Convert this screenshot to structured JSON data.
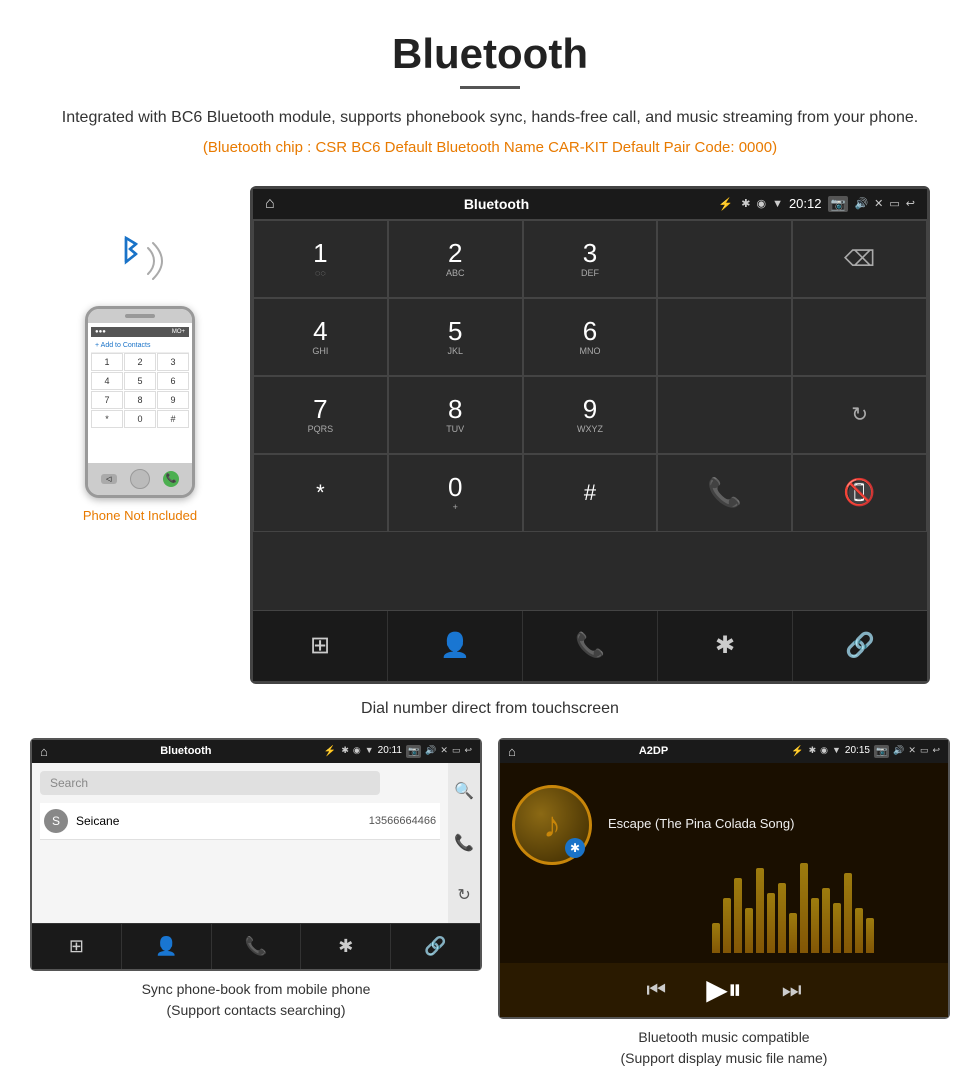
{
  "header": {
    "title": "Bluetooth",
    "description": "Integrated with BC6 Bluetooth module, supports phonebook sync, hands-free call, and music streaming from your phone.",
    "tech_info": "(Bluetooth chip : CSR BC6     Default Bluetooth Name CAR-KIT     Default Pair Code: 0000)"
  },
  "car_screen": {
    "status_bar": {
      "title": "Bluetooth",
      "time": "20:12",
      "usb_icon": "⚡",
      "bt_icon": "✱",
      "location_icon": "◉",
      "signal_icon": "▼",
      "camera_icon": "📷",
      "volume_icon": "🔊",
      "close_icon": "✕",
      "window_icon": "▭",
      "back_icon": "↩"
    },
    "keypad": {
      "rows": [
        [
          {
            "num": "1",
            "letters": "◌◌"
          },
          {
            "num": "2",
            "letters": "ABC"
          },
          {
            "num": "3",
            "letters": "DEF"
          },
          {
            "num": "",
            "letters": "",
            "type": "empty"
          },
          {
            "num": "",
            "letters": "",
            "type": "backspace"
          }
        ],
        [
          {
            "num": "4",
            "letters": "GHI"
          },
          {
            "num": "5",
            "letters": "JKL"
          },
          {
            "num": "6",
            "letters": "MNO"
          },
          {
            "num": "",
            "letters": "",
            "type": "empty"
          },
          {
            "num": "",
            "letters": "",
            "type": "empty"
          }
        ],
        [
          {
            "num": "7",
            "letters": "PQRS"
          },
          {
            "num": "8",
            "letters": "TUV"
          },
          {
            "num": "9",
            "letters": "WXYZ"
          },
          {
            "num": "",
            "letters": "",
            "type": "empty"
          },
          {
            "num": "",
            "letters": "",
            "type": "refresh"
          }
        ],
        [
          {
            "num": "*",
            "letters": ""
          },
          {
            "num": "0",
            "letters": "+",
            "type": "zero"
          },
          {
            "num": "#",
            "letters": ""
          },
          {
            "num": "",
            "letters": "",
            "type": "call_green"
          },
          {
            "num": "",
            "letters": "",
            "type": "call_red"
          }
        ]
      ]
    },
    "nav_items": [
      "⊞",
      "👤",
      "📞",
      "✱",
      "🔗"
    ]
  },
  "dial_caption": "Dial number direct from touchscreen",
  "phone_illustration": {
    "not_included": "Phone Not Included"
  },
  "phonebook_screen": {
    "status_bar": {
      "title": "Bluetooth",
      "time": "20:11"
    },
    "search_placeholder": "Search",
    "contacts": [
      {
        "initial": "S",
        "name": "Seicane",
        "phone": "13566664466"
      }
    ],
    "caption_line1": "Sync phone-book from mobile phone",
    "caption_line2": "(Support contacts searching)"
  },
  "music_screen": {
    "status_bar": {
      "title": "A2DP",
      "time": "20:15"
    },
    "song_title": "Escape (The Pina Colada Song)",
    "eq_bars": [
      30,
      55,
      75,
      45,
      85,
      60,
      70,
      40,
      90,
      55,
      65,
      50,
      80,
      45,
      35
    ],
    "caption_line1": "Bluetooth music compatible",
    "caption_line2": "(Support display music file name)"
  },
  "colors": {
    "accent_orange": "#e87a00",
    "screen_bg": "#2a2a2a",
    "screen_border": "#444"
  }
}
